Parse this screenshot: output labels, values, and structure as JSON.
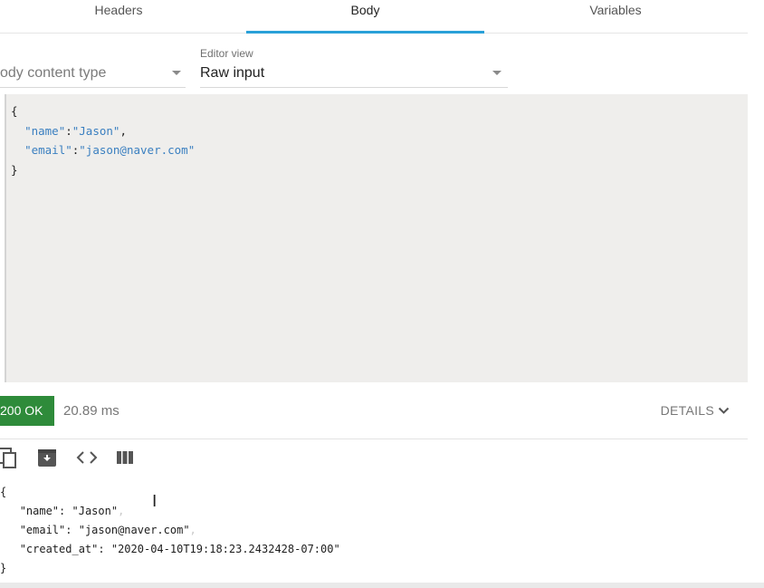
{
  "tabs": [
    {
      "label": "Headers",
      "active": false
    },
    {
      "label": "Body",
      "active": true
    },
    {
      "label": "Variables",
      "active": false
    }
  ],
  "body_content_type": {
    "placeholder": "ody content type"
  },
  "editor_view": {
    "label": "Editor view",
    "value": "Raw input"
  },
  "request_body": {
    "open": "{",
    "name_key": "\"name\"",
    "name_value": "\"Jason\"",
    "email_key": "\"email\"",
    "email_value": "\"jason@naver.com\"",
    "close": "}"
  },
  "response": {
    "status": "200 OK",
    "time": "20.89 ms",
    "details_label": "DETAILS",
    "toolbar_icons": [
      "copy-icon",
      "download-icon",
      "code-icon",
      "columns-icon"
    ],
    "body": {
      "open": "{",
      "name_key": "\"name\"",
      "name_value": "\"Jason\"",
      "email_key": "\"email\"",
      "email_value": "\"jason@naver.com\"",
      "created_key": "\"created_at\"",
      "created_value": "\"2020-04-10T19:18:23.2432428-07:00\"",
      "close": "}"
    }
  },
  "colors": {
    "accent": "#2aa0d8",
    "success": "#2e8b3a",
    "editor_bg": "#efeeec",
    "json_key": "#3a7fc0"
  }
}
